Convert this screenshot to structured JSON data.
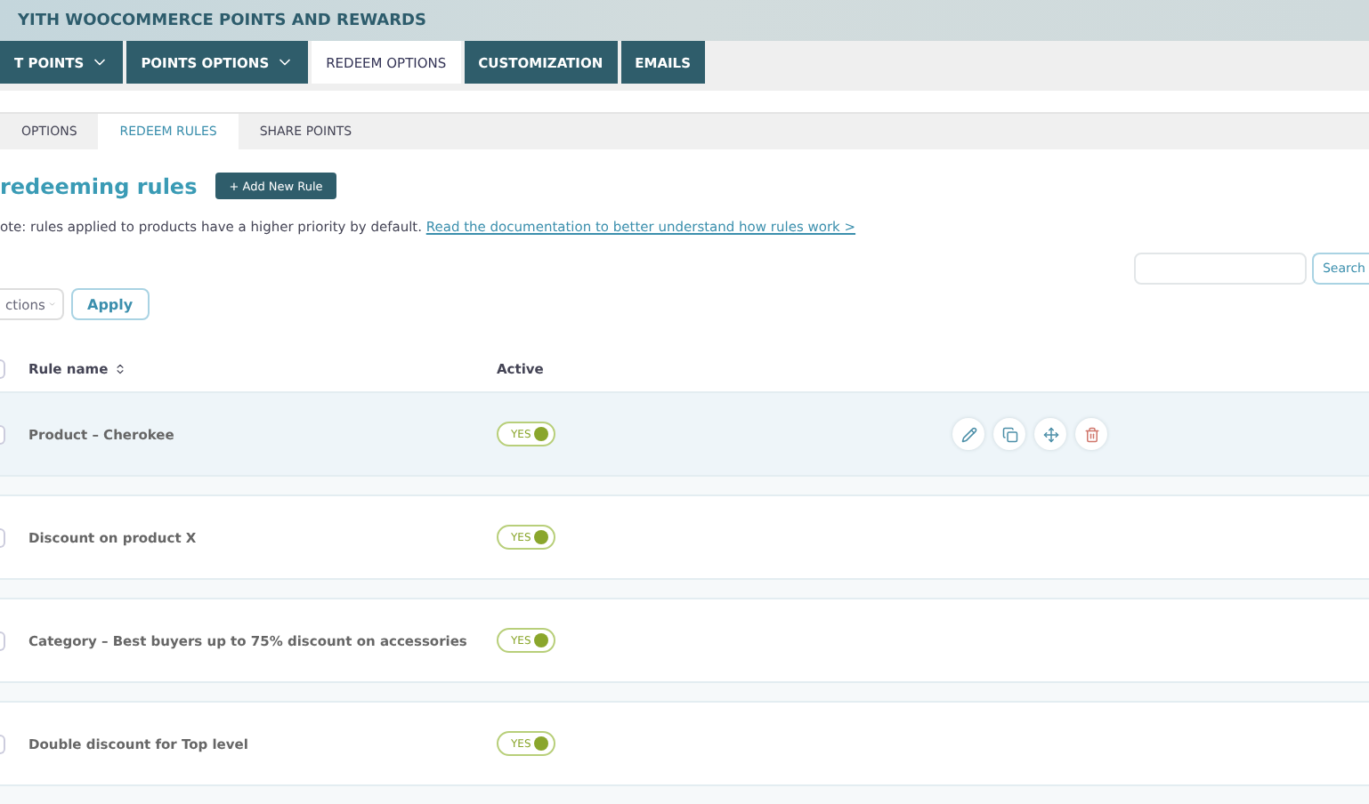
{
  "header": {
    "title": "YITH WOOCOMMERCE POINTS AND REWARDS"
  },
  "tabs": [
    {
      "label": "T POINTS",
      "dropdown": true,
      "selected": false
    },
    {
      "label": "POINTS OPTIONS",
      "dropdown": true,
      "selected": false
    },
    {
      "label": "REDEEM OPTIONS",
      "dropdown": false,
      "selected": true
    },
    {
      "label": "CUSTOMIZATION",
      "dropdown": false,
      "selected": false
    },
    {
      "label": "EMAILS",
      "dropdown": false,
      "selected": false
    }
  ],
  "subtabs": [
    {
      "label": "OPTIONS",
      "selected": false
    },
    {
      "label": "REDEEM RULES",
      "selected": true
    },
    {
      "label": "SHARE POINTS",
      "selected": false
    }
  ],
  "heading": "redeeming rules",
  "add_button": "+ Add New Rule",
  "note": {
    "text": "ote: rules applied to products have a higher priority by default.",
    "link": "Read the documentation to better understand how rules work >"
  },
  "search": {
    "button": "Search"
  },
  "bulk": {
    "select": "ctions",
    "apply": "Apply"
  },
  "table": {
    "select_all_checked": false,
    "columns": [
      "Rule name",
      "Active"
    ],
    "rows": [
      {
        "name": "Product – Cherokee",
        "active_label": "YES",
        "active": true,
        "highlighted": true,
        "checked": false
      },
      {
        "name": "Discount on product X",
        "active_label": "YES",
        "active": true,
        "highlighted": false,
        "checked": false
      },
      {
        "name": "Category – Best buyers up to 75% discount on accessories",
        "active_label": "YES",
        "active": true,
        "highlighted": false,
        "checked": false
      },
      {
        "name": "Double discount for Top level",
        "active_label": "YES",
        "active": true,
        "highlighted": false,
        "checked": false
      }
    ]
  }
}
